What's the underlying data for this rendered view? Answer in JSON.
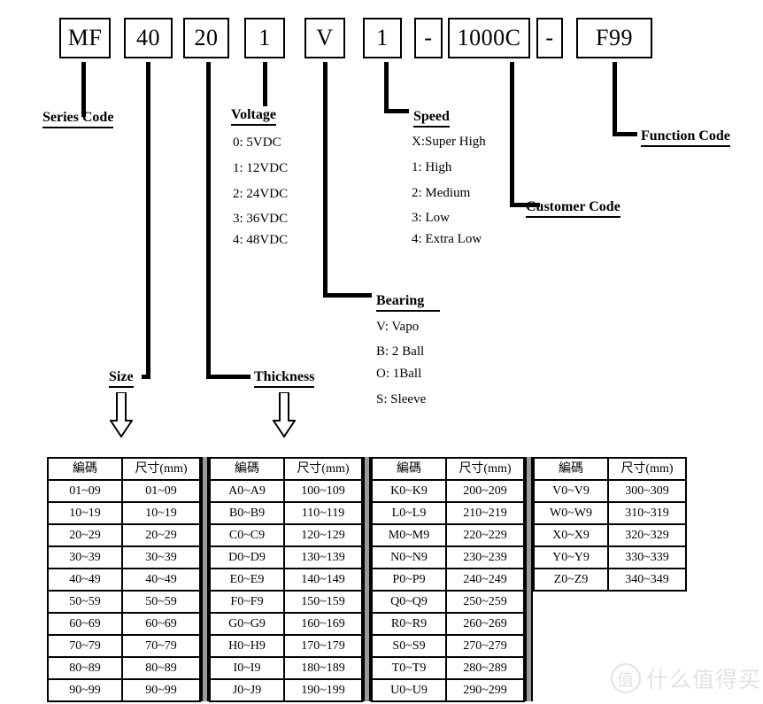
{
  "part_number": {
    "segments": [
      {
        "text": "MF",
        "name": "series-code"
      },
      {
        "text": "40",
        "name": "size"
      },
      {
        "text": "20",
        "name": "thickness"
      },
      {
        "text": "1",
        "name": "voltage"
      },
      {
        "text": "V",
        "name": "bearing"
      },
      {
        "text": "1",
        "name": "speed"
      },
      {
        "text": "-",
        "name": "dash-1"
      },
      {
        "text": "1000C",
        "name": "customer-code"
      },
      {
        "text": "-",
        "name": "dash-2"
      },
      {
        "text": "F99",
        "name": "function-code"
      }
    ]
  },
  "fields": {
    "series_code": {
      "title": "Series Code"
    },
    "size": {
      "title": "Size"
    },
    "thickness": {
      "title": "Thickness"
    },
    "voltage": {
      "title": "Voltage",
      "options": [
        "0: 5VDC",
        "1: 12VDC",
        "2: 24VDC",
        "3: 36VDC",
        "4: 48VDC"
      ]
    },
    "bearing": {
      "title": "Bearing",
      "options": [
        "V: Vapo",
        "B: 2 Ball",
        "O: 1Ball",
        "S: Sleeve"
      ]
    },
    "speed": {
      "title": "Speed",
      "options": [
        "X:Super High",
        "1: High",
        "2: Medium",
        "3: Low",
        "4: Extra Low"
      ]
    },
    "customer_code": {
      "title": "Customer Code"
    },
    "function_code": {
      "title": "Function Code"
    }
  },
  "code_table": {
    "headers": [
      "編碼",
      "尺寸(mm)"
    ],
    "groups": [
      {
        "rows": [
          [
            "01~09",
            "01~09"
          ],
          [
            "10~19",
            "10~19"
          ],
          [
            "20~29",
            "20~29"
          ],
          [
            "30~39",
            "30~39"
          ],
          [
            "40~49",
            "40~49"
          ],
          [
            "50~59",
            "50~59"
          ],
          [
            "60~69",
            "60~69"
          ],
          [
            "70~79",
            "70~79"
          ],
          [
            "80~89",
            "80~89"
          ],
          [
            "90~99",
            "90~99"
          ]
        ]
      },
      {
        "rows": [
          [
            "A0~A9",
            "100~109"
          ],
          [
            "B0~B9",
            "110~119"
          ],
          [
            "C0~C9",
            "120~129"
          ],
          [
            "D0~D9",
            "130~139"
          ],
          [
            "E0~E9",
            "140~149"
          ],
          [
            "F0~F9",
            "150~159"
          ],
          [
            "G0~G9",
            "160~169"
          ],
          [
            "H0~H9",
            "170~179"
          ],
          [
            "I0~I9",
            "180~189"
          ],
          [
            "J0~J9",
            "190~199"
          ]
        ]
      },
      {
        "rows": [
          [
            "K0~K9",
            "200~209"
          ],
          [
            "L0~L9",
            "210~219"
          ],
          [
            "M0~M9",
            "220~229"
          ],
          [
            "N0~N9",
            "230~239"
          ],
          [
            "P0~P9",
            "240~249"
          ],
          [
            "Q0~Q9",
            "250~259"
          ],
          [
            "R0~R9",
            "260~269"
          ],
          [
            "S0~S9",
            "270~279"
          ],
          [
            "T0~T9",
            "280~289"
          ],
          [
            "U0~U9",
            "290~299"
          ]
        ]
      },
      {
        "rows": [
          [
            "V0~V9",
            "300~309"
          ],
          [
            "W0~W9",
            "310~319"
          ],
          [
            "X0~X9",
            "320~329"
          ],
          [
            "Y0~Y9",
            "330~339"
          ],
          [
            "Z0~Z9",
            "340~349"
          ]
        ]
      }
    ]
  },
  "watermark": {
    "mark": "值",
    "text": "什么值得买"
  },
  "colors": {
    "ink": "#000000",
    "paper": "#ffffff",
    "gap": "#9a9a9a",
    "watermark": "#e3e3e3"
  }
}
